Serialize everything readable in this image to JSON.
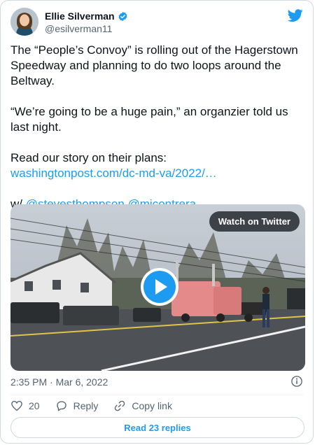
{
  "author": {
    "name": "Ellie Silverman",
    "handle": "@esilverman11"
  },
  "tweet": {
    "para1": "The “People’s Convoy” is rolling out of the Hagerstown Speedway and planning to do two loops around the Beltway.",
    "para2": "“We’re going to be a huge pain,” an organzier told us last night.",
    "para3_text": "Read our story on their plans:",
    "para3_link": "washingtonpost.com/dc-md-va/2022/…",
    "para4_prefix": "w/ ",
    "mention1": "@stevesthompson",
    "mention2": "@mjcontrera"
  },
  "media": {
    "watch_label": "Watch on Twitter"
  },
  "meta": {
    "timestamp": "2:35 PM · Mar 6, 2022"
  },
  "actions": {
    "likes": "20",
    "reply_label": "Reply",
    "copy_label": "Copy link"
  },
  "read_replies": "Read 23 replies",
  "colors": {
    "accent": "#1d9bf0",
    "text": "#0f1419",
    "muted": "#536471"
  },
  "icons": [
    "verified-icon",
    "twitter-bird-icon",
    "play-icon",
    "info-icon",
    "heart-icon",
    "reply-icon",
    "link-icon"
  ]
}
